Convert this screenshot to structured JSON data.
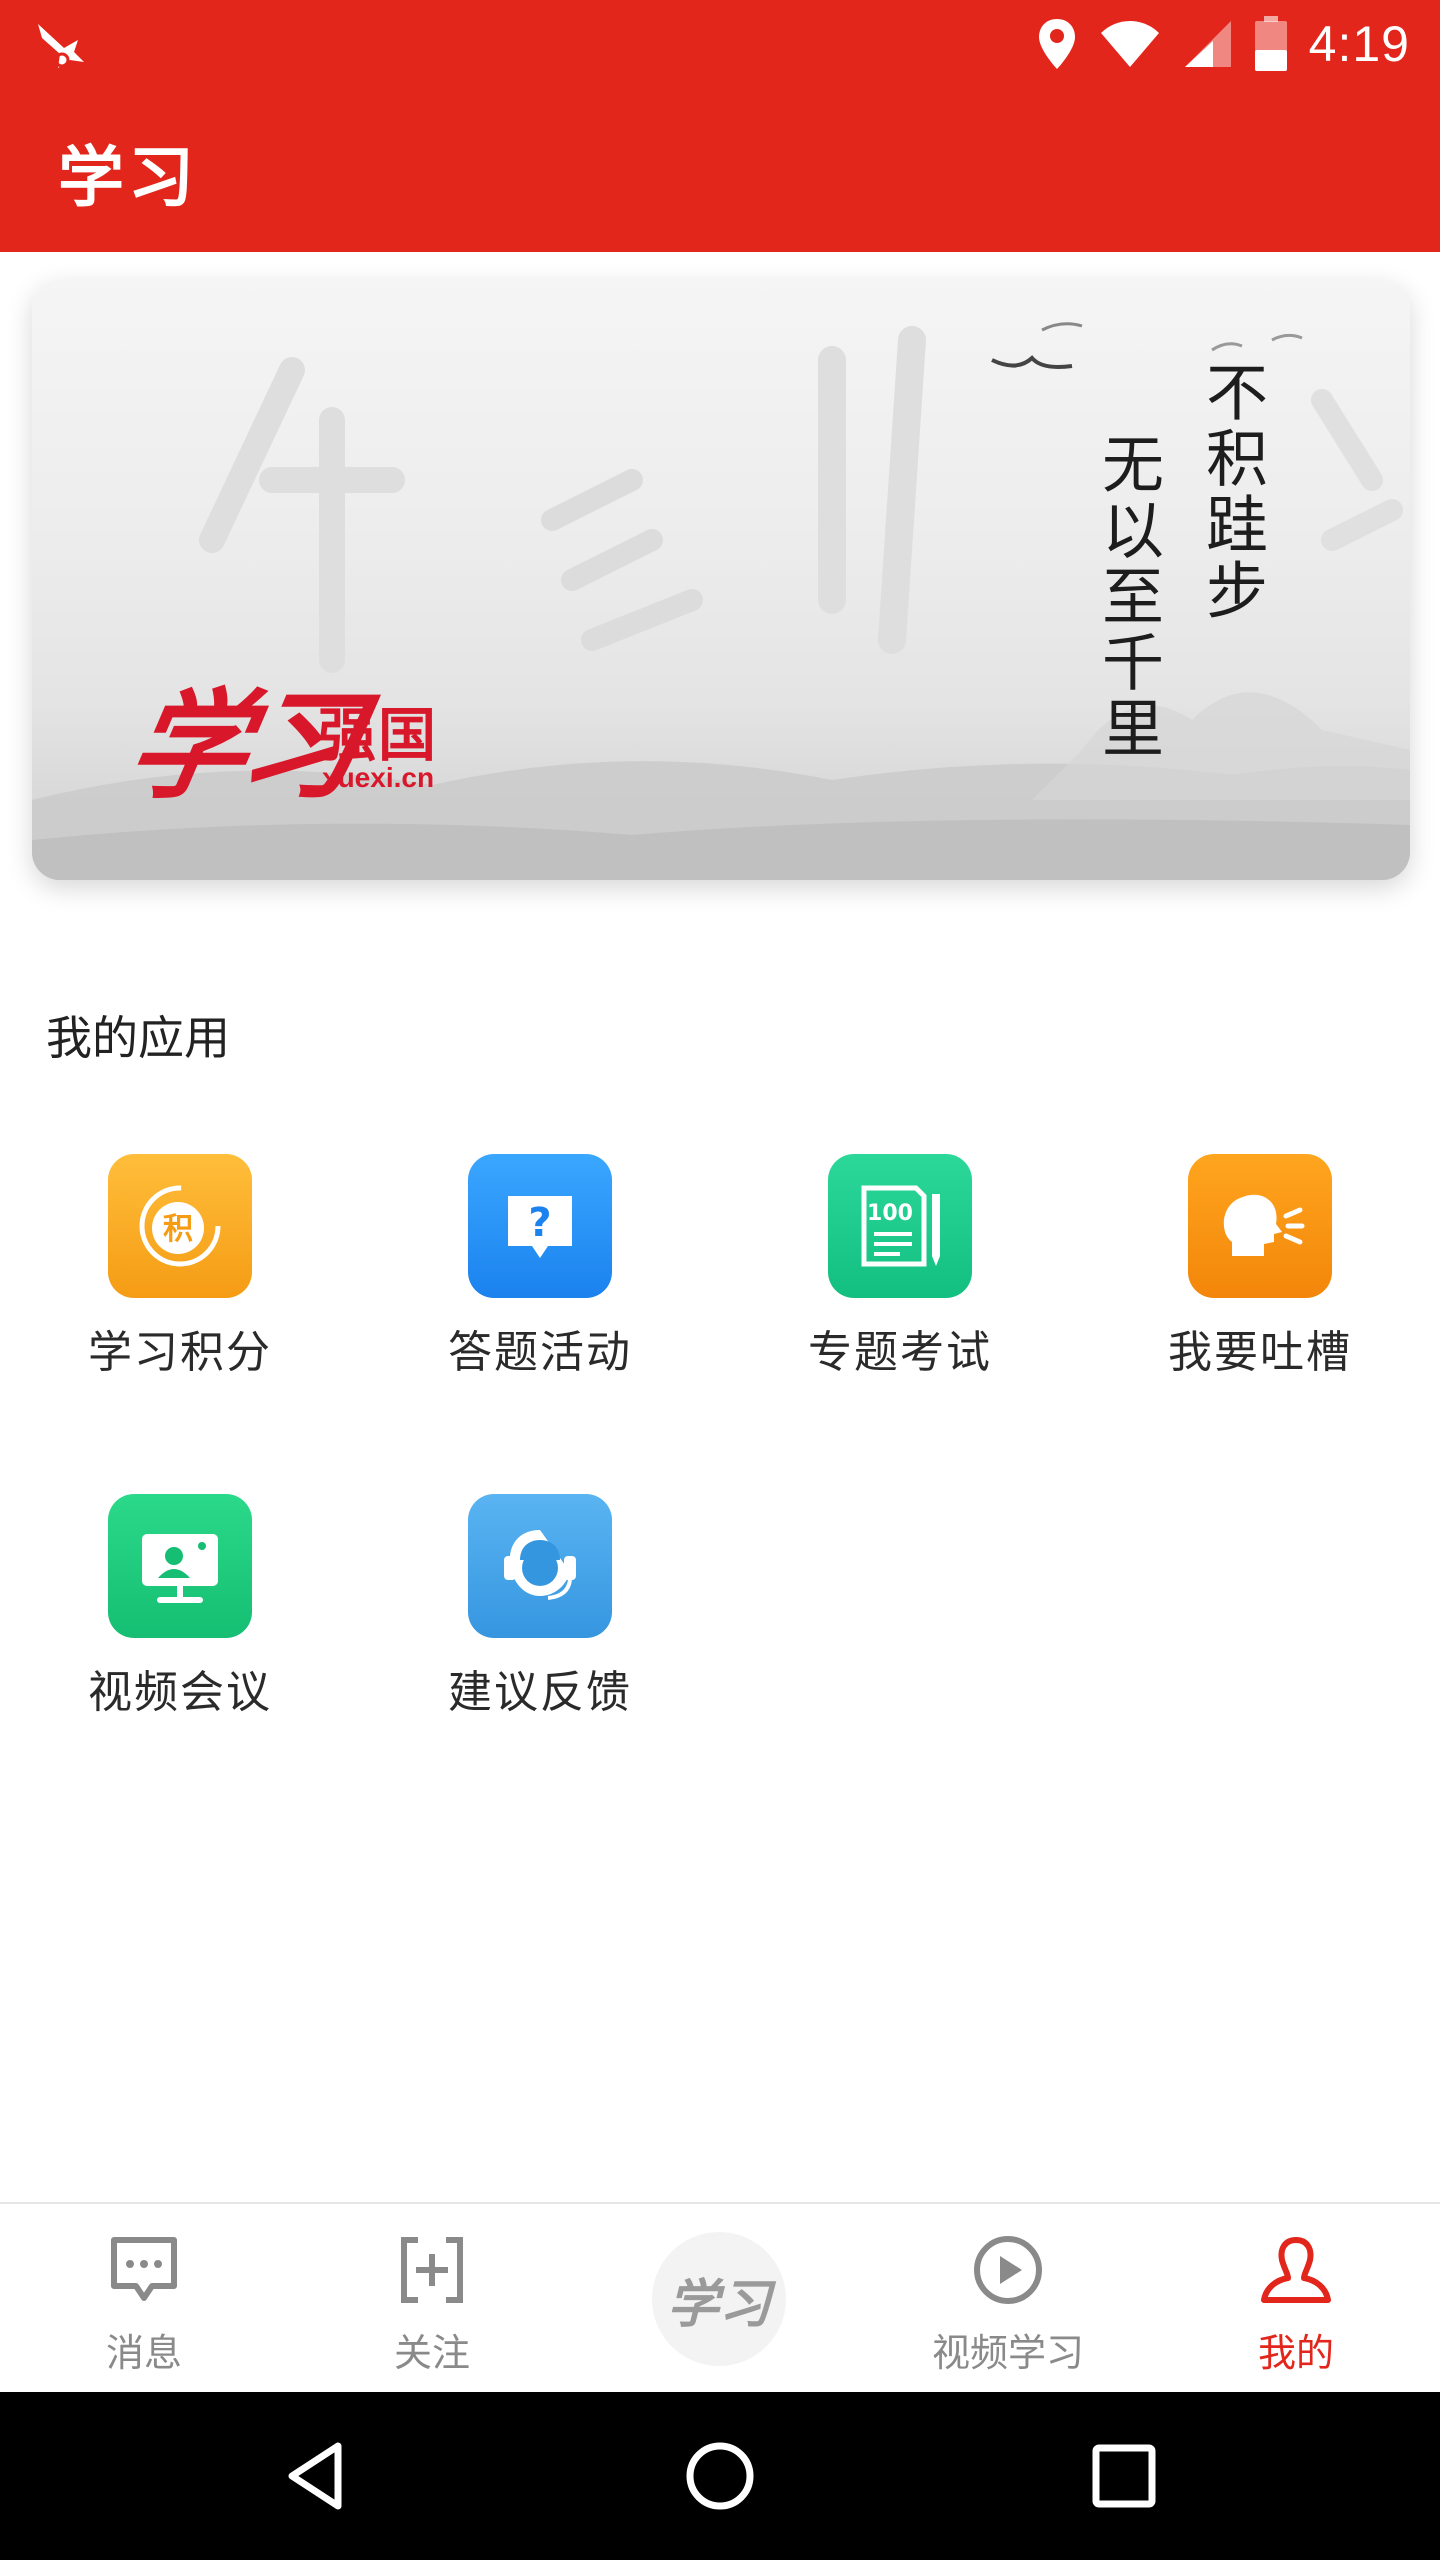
{
  "status_bar": {
    "time": "4:19",
    "icons": [
      "notification-app-icon",
      "location-icon",
      "wifi-icon",
      "signal-icon",
      "battery-icon"
    ]
  },
  "app_bar": {
    "title": "学习"
  },
  "banner": {
    "logo_script": "学习",
    "logo_name": "强国",
    "logo_url": "xuexi.cn",
    "poem_line1": "不积跬步",
    "poem_line2": "无以至千里"
  },
  "my_apps": {
    "title": "我的应用",
    "items": [
      {
        "label": "学习积分",
        "icon": "points-icon",
        "glyph": "积",
        "color": "#f7a21b"
      },
      {
        "label": "答题活动",
        "icon": "quiz-icon",
        "glyph": "?",
        "color": "#2196f3"
      },
      {
        "label": "专题考试",
        "icon": "exam-icon",
        "glyph": "100",
        "color": "#1cc98a"
      },
      {
        "label": "我要吐槽",
        "icon": "complain-icon",
        "glyph": "",
        "color": "#f78c0a"
      },
      {
        "label": "视频会议",
        "icon": "video-meeting-icon",
        "glyph": "",
        "color": "#1fcb7e"
      },
      {
        "label": "建议反馈",
        "icon": "feedback-icon",
        "glyph": "",
        "color": "#3fa2ea"
      }
    ]
  },
  "bottom_nav": {
    "items": [
      {
        "label": "消息",
        "icon": "message-icon",
        "active": false
      },
      {
        "label": "关注",
        "icon": "follow-icon",
        "active": false
      },
      {
        "label": "",
        "icon": "xuexi-logo-icon",
        "active": false
      },
      {
        "label": "视频学习",
        "icon": "video-play-icon",
        "active": false
      },
      {
        "label": "我的",
        "icon": "profile-icon",
        "active": true
      }
    ],
    "center_glyph": "学习"
  },
  "system_nav": {
    "buttons": [
      "back-icon",
      "home-icon",
      "recents-icon"
    ]
  },
  "colors": {
    "brand_red": "#e3261b",
    "inactive_gray": "#8a8a8a"
  }
}
